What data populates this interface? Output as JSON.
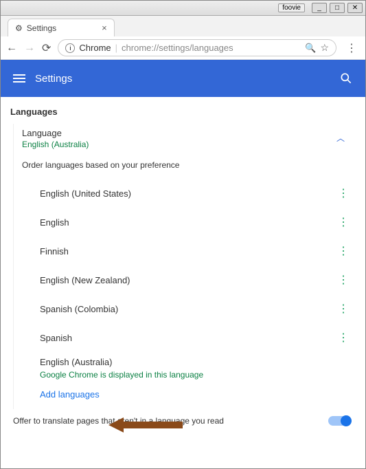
{
  "window": {
    "badge": "foovie",
    "controls": {
      "min": "_",
      "max": "□",
      "close": "✕"
    }
  },
  "tab": {
    "icon": "⚙",
    "title": "Settings"
  },
  "nav": {
    "chrome_label": "Chrome",
    "url": "chrome://settings/languages"
  },
  "header": {
    "title": "Settings"
  },
  "section": {
    "heading": "Languages",
    "lang_header": {
      "title": "Language",
      "subtitle": "English (Australia)"
    },
    "order_label": "Order languages based on your preference",
    "items": [
      {
        "name": "English (United States)"
      },
      {
        "name": "English"
      },
      {
        "name": "Finnish"
      },
      {
        "name": "English (New Zealand)"
      },
      {
        "name": "Spanish (Colombia)"
      },
      {
        "name": "Spanish"
      },
      {
        "name": "English (Australia)",
        "note": "Google Chrome is displayed in this language"
      }
    ],
    "add_label": "Add languages",
    "translate_label": "Offer to translate pages that aren't in a language you read"
  }
}
